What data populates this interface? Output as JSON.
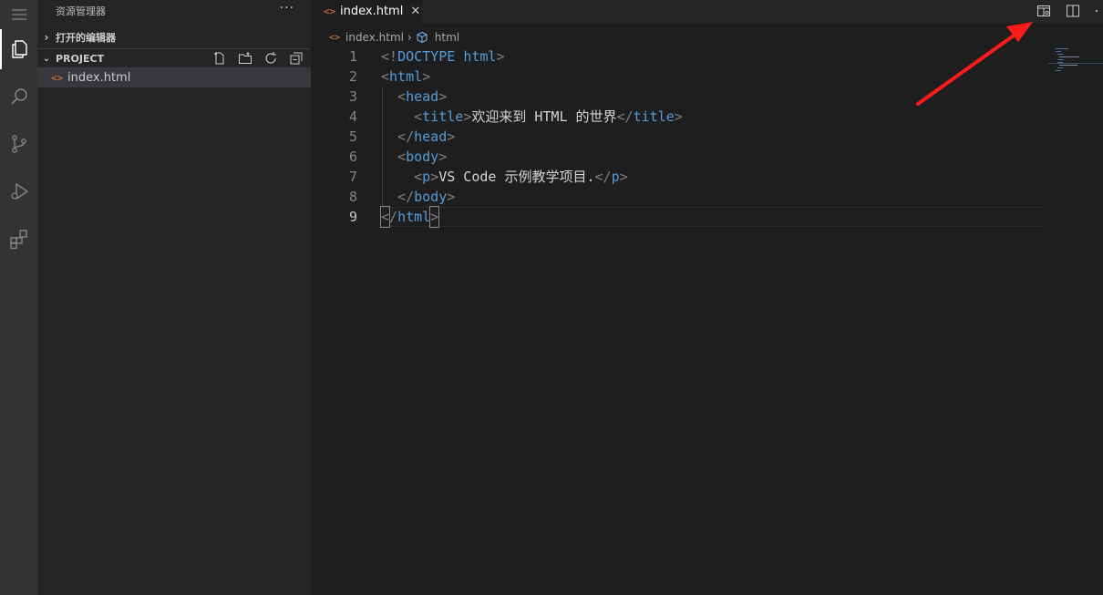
{
  "sidebar": {
    "title": "资源管理器",
    "more": "···",
    "open_editors_label": "打开的编辑器",
    "project_label": "PROJECT",
    "files": [
      {
        "name": "index.html",
        "icon": "<>"
      }
    ]
  },
  "tabs": [
    {
      "label": "index.html",
      "icon": "<>",
      "close": "✕"
    }
  ],
  "breadcrumb": {
    "file": "index.html",
    "symbol": "html"
  },
  "editor": {
    "current_line": 9,
    "lines": [
      {
        "n": "1",
        "parts": [
          {
            "t": "<!",
            "c": "punc"
          },
          {
            "t": "DOCTYPE",
            "c": "tag"
          },
          {
            "t": " ",
            "c": "txt"
          },
          {
            "t": "html",
            "c": "tag"
          },
          {
            "t": ">",
            "c": "punc"
          }
        ]
      },
      {
        "n": "2",
        "parts": [
          {
            "t": "<",
            "c": "punc"
          },
          {
            "t": "html",
            "c": "tag"
          },
          {
            "t": ">",
            "c": "punc"
          }
        ]
      },
      {
        "n": "3",
        "parts": [
          {
            "t": "  <",
            "c": "punc"
          },
          {
            "t": "head",
            "c": "tag"
          },
          {
            "t": ">",
            "c": "punc"
          }
        ]
      },
      {
        "n": "4",
        "parts": [
          {
            "t": "    <",
            "c": "punc"
          },
          {
            "t": "title",
            "c": "tag"
          },
          {
            "t": ">",
            "c": "punc"
          },
          {
            "t": "欢迎来到 HTML 的世界",
            "c": "txt"
          },
          {
            "t": "</",
            "c": "punc"
          },
          {
            "t": "title",
            "c": "tag"
          },
          {
            "t": ">",
            "c": "punc"
          }
        ]
      },
      {
        "n": "5",
        "parts": [
          {
            "t": "  </",
            "c": "punc"
          },
          {
            "t": "head",
            "c": "tag"
          },
          {
            "t": ">",
            "c": "punc"
          }
        ]
      },
      {
        "n": "6",
        "parts": [
          {
            "t": "  <",
            "c": "punc"
          },
          {
            "t": "body",
            "c": "tag"
          },
          {
            "t": ">",
            "c": "punc"
          }
        ]
      },
      {
        "n": "7",
        "parts": [
          {
            "t": "    <",
            "c": "punc"
          },
          {
            "t": "p",
            "c": "tag"
          },
          {
            "t": ">",
            "c": "punc"
          },
          {
            "t": "VS Code 示例教学项目.",
            "c": "txt"
          },
          {
            "t": "</",
            "c": "punc"
          },
          {
            "t": "p",
            "c": "tag"
          },
          {
            "t": ">",
            "c": "punc"
          }
        ]
      },
      {
        "n": "8",
        "parts": [
          {
            "t": "  </",
            "c": "punc"
          },
          {
            "t": "body",
            "c": "tag"
          },
          {
            "t": ">",
            "c": "punc"
          }
        ]
      },
      {
        "n": "9",
        "parts": [
          {
            "t": "<",
            "c": "punc bm"
          },
          {
            "t": "/",
            "c": "punc"
          },
          {
            "t": "html",
            "c": "tag"
          },
          {
            "t": ">",
            "c": "punc bm"
          }
        ]
      }
    ]
  },
  "colors": {
    "arrow": "#ff1a1a",
    "tag": "#569cd6",
    "file_icon": "#e37933"
  }
}
